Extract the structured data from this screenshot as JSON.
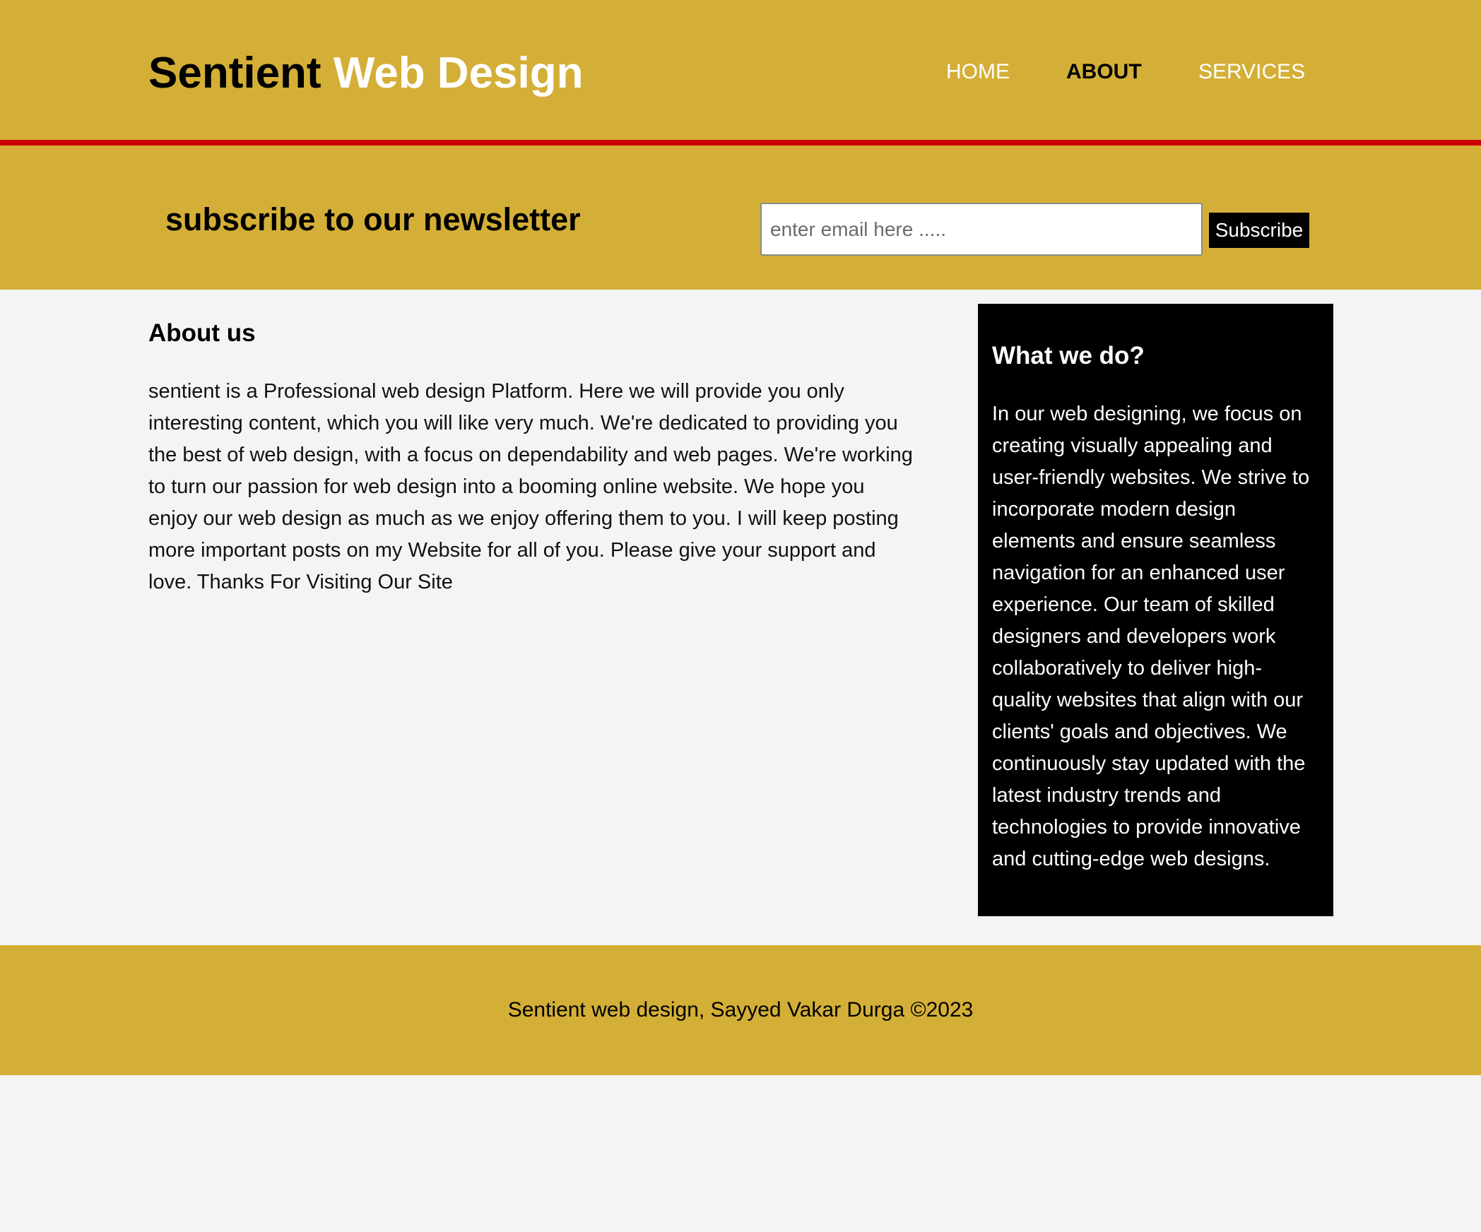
{
  "header": {
    "brand_part1": "Sentient",
    "brand_part2": "Web Design",
    "nav": [
      {
        "label": "HOME",
        "current": false
      },
      {
        "label": "ABOUT",
        "current": true
      },
      {
        "label": "SERVICES",
        "current": false
      }
    ]
  },
  "newsletter": {
    "heading": "subscribe to our newsletter",
    "email_placeholder": "enter email here .....",
    "button_label": "Subscribe"
  },
  "main": {
    "title": "About us",
    "body": "sentient is a Professional web design Platform. Here we will provide you only interesting content, which you will like very much. We're dedicated to providing you the best of web design, with a focus on dependability and web pages. We're working to turn our passion for web design into a booming online website. We hope you enjoy our web design as much as we enjoy offering them to you. I will keep posting more important posts on my Website for all of you. Please give your support and love. Thanks For Visiting Our Site"
  },
  "sidebar": {
    "title": "What we do?",
    "body": "In our web designing, we focus on creating visually appealing and user-friendly websites. We strive to incorporate modern design elements and ensure seamless navigation for an enhanced user experience. Our team of skilled designers and developers work collaboratively to deliver high-quality websites that align with our clients' goals and objectives. We continuously stay updated with the latest industry trends and technologies to provide innovative and cutting-edge web designs."
  },
  "footer": {
    "text": "Sentient web design, Sayyed Vakar Durga ©2023"
  },
  "colors": {
    "primary": "#d4af37",
    "accent_border": "#cc0000",
    "sidebar_bg": "#000000",
    "page_bg": "#f4f4f4"
  }
}
